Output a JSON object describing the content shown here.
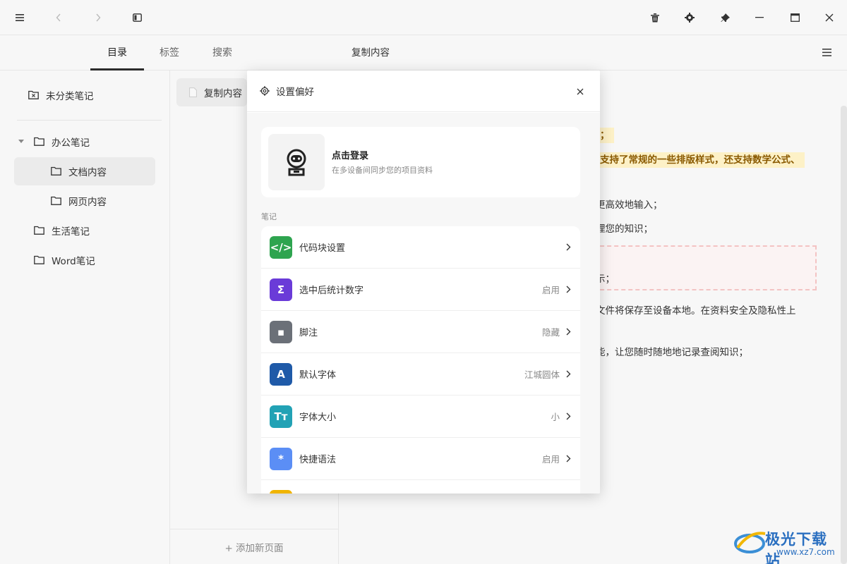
{
  "colors": {
    "accent": "#2b2b2b",
    "highlight_bg": "#fdf1c7",
    "highlight_text": "#8a5a00"
  },
  "topbar": {
    "left_icons": [
      "menu-icon",
      "back-icon",
      "forward-icon",
      "sidebar-toggle-icon"
    ],
    "right_icons": [
      "trash-icon",
      "gear-icon",
      "pin-icon",
      "minimize-icon",
      "maximize-icon",
      "close-icon"
    ]
  },
  "tabs": [
    {
      "label": "目录",
      "active": true
    },
    {
      "label": "标签",
      "active": false
    },
    {
      "label": "搜索",
      "active": false
    }
  ],
  "sidebar": {
    "uncategorized": "未分类笔记",
    "folders": {
      "office": "办公笔记",
      "docs": "文档内容",
      "web": "网页内容",
      "life": "生活笔记",
      "word": "Word笔记"
    }
  },
  "page_list": {
    "current_page": "复制内容",
    "add_page": "+ 添加新页面"
  },
  "content": {
    "title": "复制内容",
    "lines": {
      "l1": "；",
      "l2": "支持了常规的一些排版样式，还支持数学公式、",
      "l3": "更高效地输入；",
      "l4": "理您的知识；",
      "l5": "示；",
      "l6": "文件将保存至设备本地。在资料安全及隐私性上",
      "l7": "能，让您随时随地地记录查阅知识；"
    }
  },
  "modal": {
    "title": "设置偏好",
    "login": {
      "title": "点击登录",
      "subtitle": "在多设备间同步您的项目资料"
    },
    "section_label": "笔记",
    "rows": [
      {
        "label": "代码块设置",
        "value": "",
        "icon": "code-icon",
        "color": "#2ea44f",
        "glyph": "</>"
      },
      {
        "label": "选中后统计数字",
        "value": "启用",
        "icon": "sigma-icon",
        "color": "#6a3bd8",
        "glyph": "Σ"
      },
      {
        "label": "脚注",
        "value": "隐藏",
        "icon": "footnote-icon",
        "color": "#6b7078",
        "glyph": "▪"
      },
      {
        "label": "默认字体",
        "value": "江城圆体",
        "icon": "font-icon",
        "color": "#1f5aa8",
        "glyph": "A"
      },
      {
        "label": "字体大小",
        "value": "小",
        "icon": "font-size-icon",
        "color": "#22a2b5",
        "glyph": "Tт"
      },
      {
        "label": "快捷语法",
        "value": "启用",
        "icon": "asterisk-icon",
        "color": "#5b8ef5",
        "glyph": "*"
      },
      {
        "label": "",
        "value": "",
        "icon": "partial-icon",
        "color": "#f0b400",
        "glyph": ""
      }
    ]
  },
  "watermark": {
    "text": "极光下载站",
    "url": "www.xz7.com"
  }
}
